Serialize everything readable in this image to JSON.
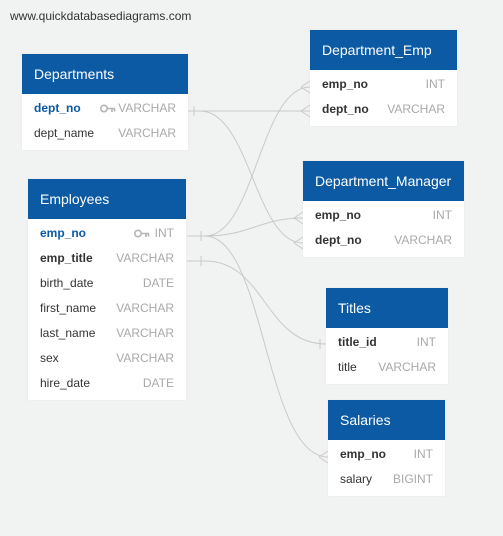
{
  "watermark": "www.quickdatabasediagrams.com",
  "colors": {
    "header": "#0b5aa3",
    "link": "#c9c9c9",
    "background": "#f1f2f2"
  },
  "tables": {
    "departments": {
      "title": "Departments",
      "rows": [
        {
          "name": "dept_no",
          "type": "VARCHAR",
          "pk": true
        },
        {
          "name": "dept_name",
          "type": "VARCHAR"
        }
      ]
    },
    "employees": {
      "title": "Employees",
      "rows": [
        {
          "name": "emp_no",
          "type": "INT",
          "pk": true
        },
        {
          "name": "emp_title",
          "type": "VARCHAR"
        },
        {
          "name": "birth_date",
          "type": "DATE"
        },
        {
          "name": "first_name",
          "type": "VARCHAR"
        },
        {
          "name": "last_name",
          "type": "VARCHAR"
        },
        {
          "name": "sex",
          "type": "VARCHAR"
        },
        {
          "name": "hire_date",
          "type": "DATE"
        }
      ]
    },
    "department_emp": {
      "title": "Department_Emp",
      "rows": [
        {
          "name": "emp_no",
          "type": "INT"
        },
        {
          "name": "dept_no",
          "type": "VARCHAR"
        }
      ]
    },
    "department_manager": {
      "title": "Department_Manager",
      "rows": [
        {
          "name": "emp_no",
          "type": "INT"
        },
        {
          "name": "dept_no",
          "type": "VARCHAR"
        }
      ]
    },
    "titles": {
      "title": "Titles",
      "rows": [
        {
          "name": "title_id",
          "type": "INT"
        },
        {
          "name": "title",
          "type": "VARCHAR"
        }
      ]
    },
    "salaries": {
      "title": "Salaries",
      "rows": [
        {
          "name": "emp_no",
          "type": "INT"
        },
        {
          "name": "salary",
          "type": "BIGINT"
        }
      ]
    }
  }
}
